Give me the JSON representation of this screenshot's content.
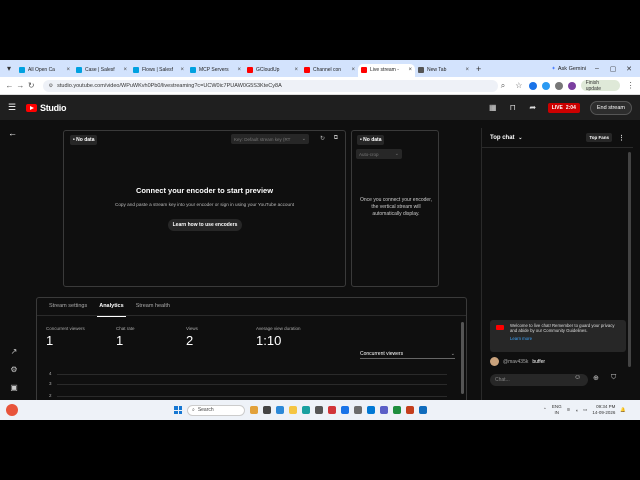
{
  "browser": {
    "tabs": [
      {
        "label": "All Open Ca",
        "icon": "salesforce-icon",
        "color": "#00a1e0",
        "active": false
      },
      {
        "label": "Case | Salesf",
        "icon": "salesforce-icon",
        "color": "#00a1e0",
        "active": false
      },
      {
        "label": "Flows | Salesf",
        "icon": "salesforce-icon",
        "color": "#00a1e0",
        "active": false
      },
      {
        "label": "MCP Servers",
        "icon": "salesforce-icon",
        "color": "#00a1e0",
        "active": false
      },
      {
        "label": "GCloudUp",
        "icon": "youtube-icon",
        "color": "#ff0000",
        "active": false
      },
      {
        "label": "Channel con",
        "icon": "youtube-icon",
        "color": "#ff0000",
        "active": false
      },
      {
        "label": "Live stream -",
        "icon": "youtube-icon",
        "color": "#ff0000",
        "active": true
      },
      {
        "label": "New Tab",
        "icon": "chrome-icon",
        "color": "#555555",
        "active": false
      }
    ],
    "new_tab": "+",
    "ask_gemini": "Ask Gemini",
    "url": "studio.youtube.com/video/WPuWKvh0Pb0/livestreaming?c=UCW0ic7PUAW0G5S3KteCy8A",
    "finish_update": "Finish update"
  },
  "studio": {
    "logo_text": "Studio",
    "live_label": "LIVE",
    "live_time": "2:04",
    "end_stream": "End stream"
  },
  "preview": {
    "no_data": "No data",
    "stream_key_placeholder": "Key: Default stream key (RT",
    "connect_title": "Connect your encoder to start preview",
    "connect_sub": "Copy and paste a stream key into your encoder or sign in using your YouTube account",
    "learn_button": "Learn how to use encoders"
  },
  "vertical": {
    "no_data": "No data",
    "autocrop": "Auto-crop",
    "text": "Once you connect your encoder, the vertical stream will automatically display."
  },
  "analytics": {
    "tabs": [
      "Stream settings",
      "Analytics",
      "Stream health"
    ],
    "active_tab": 1,
    "metrics": [
      {
        "label": "Concurrent viewers",
        "value": "1"
      },
      {
        "label": "Chat rate",
        "value": "1"
      },
      {
        "label": "Views",
        "value": "2"
      },
      {
        "label": "Average view duration",
        "value": "1:10"
      }
    ],
    "select": "Concurrent viewers",
    "y_ticks": [
      "4",
      "3",
      "2"
    ]
  },
  "chat": {
    "title": "Top chat",
    "top_fans": "Top Fans",
    "welcome": "Welcome to live chat! Remember to guard your privacy and abide by our Community Guidelines.",
    "learn_more": "Learn more",
    "message_author": "@mav435k",
    "message_text": "buffer",
    "input_placeholder": "Chat..."
  },
  "taskbar": {
    "search": "Search",
    "lang1": "ENG",
    "lang2": "IN",
    "time": "09:34 PM",
    "date": "14-09-2026"
  }
}
